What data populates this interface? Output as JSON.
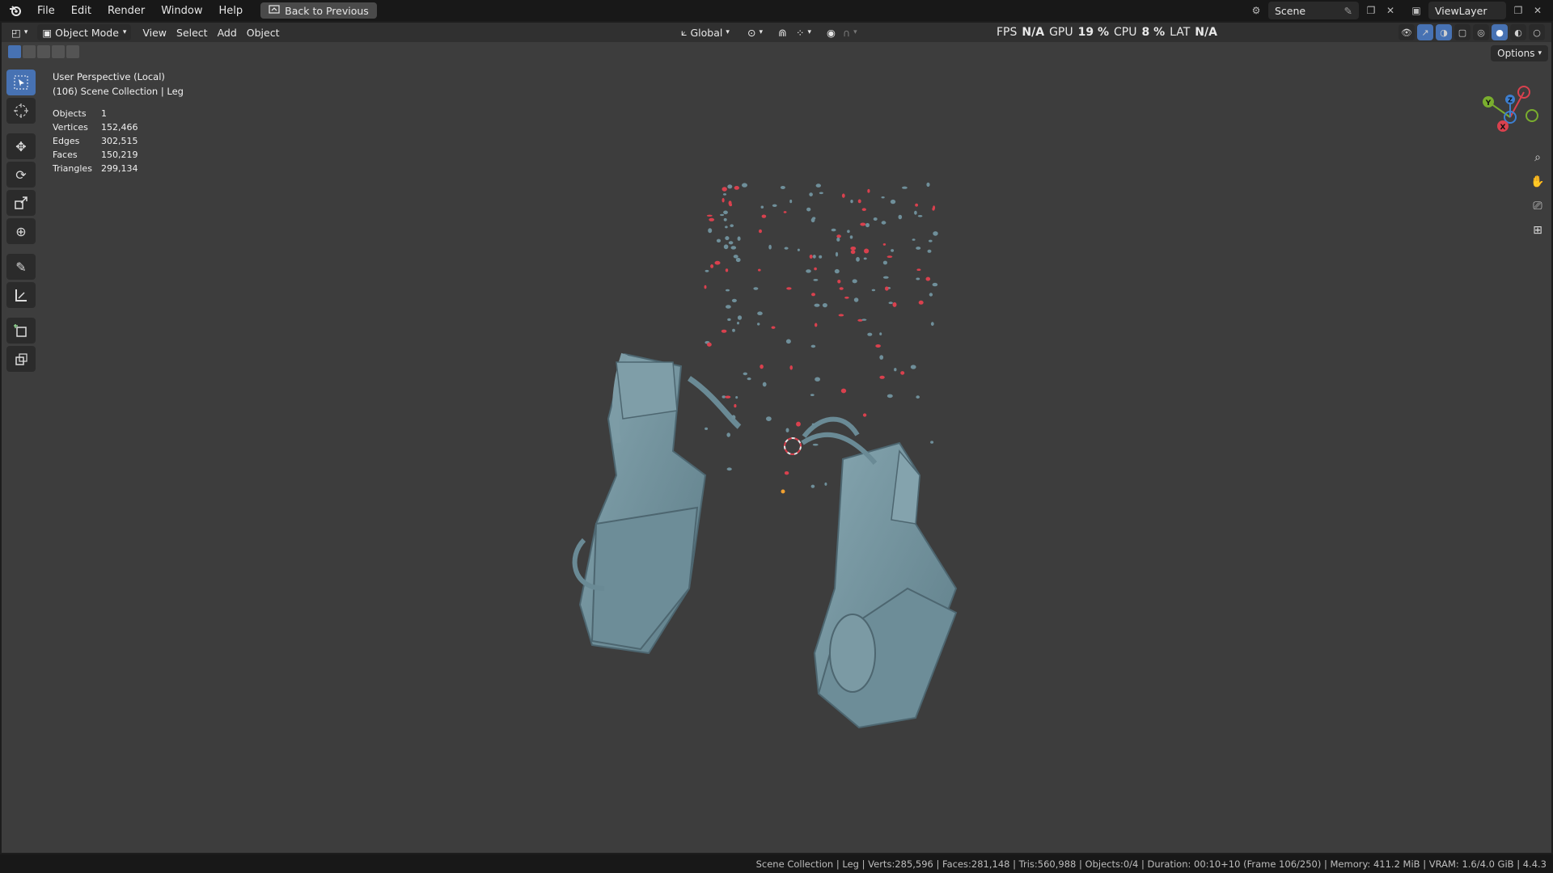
{
  "menu": {
    "file": "File",
    "edit": "Edit",
    "render": "Render",
    "window": "Window",
    "help": "Help",
    "back_button": "Back to Previous"
  },
  "scene_selector": {
    "scene_name": "Scene",
    "view_layer": "ViewLayer"
  },
  "viewport_header": {
    "mode": "Object Mode",
    "view": "View",
    "select": "Select",
    "add": "Add",
    "object": "Object",
    "transform_orientation": "Global",
    "options": "Options"
  },
  "perf": {
    "fps_label": "FPS",
    "fps_value": "N/A",
    "gpu_label": "GPU",
    "gpu_value": "19 %",
    "cpu_label": "CPU",
    "cpu_value": "8 %",
    "lat_label": "LAT",
    "lat_value": "N/A"
  },
  "overlay": {
    "perspective": "User Perspective (Local)",
    "collection": "(106) Scene Collection | Leg",
    "stats": [
      {
        "label": "Objects",
        "value": "1"
      },
      {
        "label": "Vertices",
        "value": "152,466"
      },
      {
        "label": "Edges",
        "value": "302,515"
      },
      {
        "label": "Faces",
        "value": "150,219"
      },
      {
        "label": "Triangles",
        "value": "299,134"
      }
    ]
  },
  "gizmo": {
    "x": "X",
    "y": "Y",
    "z": "Z"
  },
  "statusbar": {
    "text": "Scene Collection | Leg | Verts:285,596 | Faces:281,148 | Tris:560,988 | Objects:0/4 | Duration: 00:10+10 (Frame 106/250) | Memory: 411.2 MiB | VRAM: 1.6/4.0 GiB | 4.4.3"
  },
  "colors": {
    "accent": "#4772b3",
    "mesh": "#6f8f9a",
    "particle_red": "#d9414e",
    "axis_x": "#d9414e",
    "axis_y": "#7aae2e",
    "axis_z": "#3d7fd1"
  }
}
